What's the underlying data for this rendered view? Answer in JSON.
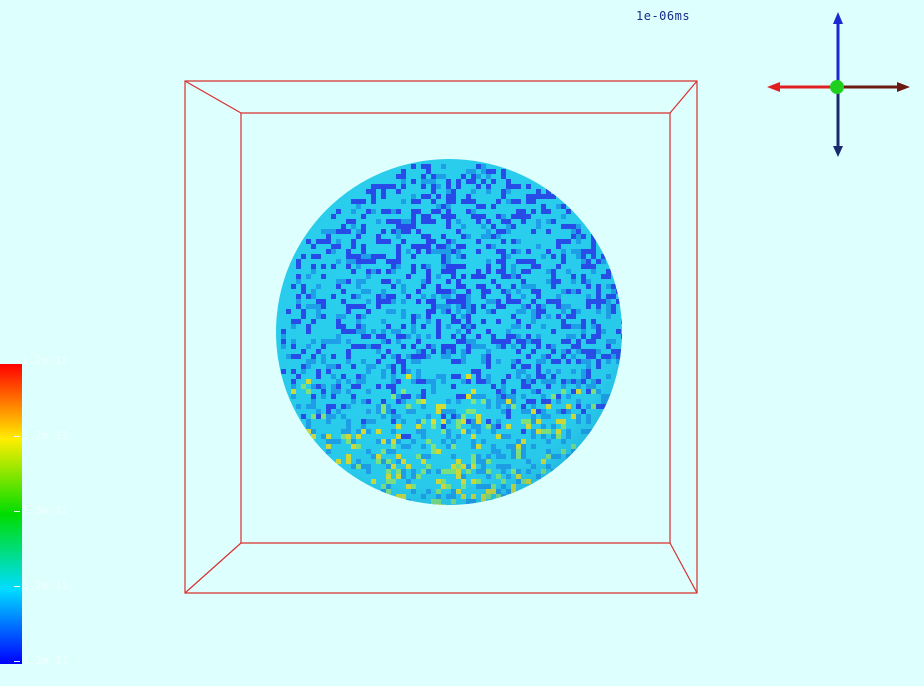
{
  "viewer": {
    "time_label": "1e-06ms",
    "background": "#ddfffd",
    "bounding_box_color": "#d93030"
  },
  "colorbar": {
    "ticks": [
      "1.2e-11",
      "1.2e-11",
      "1.3e-11",
      "1.2e-11",
      "1.2e-11"
    ],
    "colors": [
      "#ff0000",
      "#ffee00",
      "#00dd00",
      "#00ddff",
      "#0000ff"
    ]
  },
  "axes_gizmo": {
    "up_axis_color": "#1a2ad0",
    "down_axis_color": "#1a2a70",
    "left_axis_color": "#e02020",
    "right_axis_color": "#6a1a10",
    "origin_color": "#20d020",
    "icon": "orientation-axes-icon"
  },
  "sphere": {
    "base_color": "#2ad0ee",
    "cold_color": "#2840e8",
    "hot_color": "#e8e020"
  }
}
